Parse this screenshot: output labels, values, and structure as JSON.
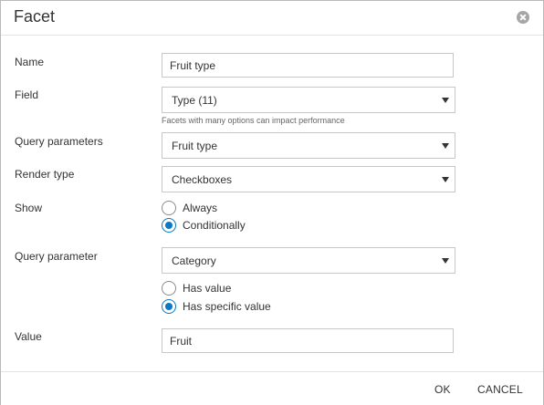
{
  "dialog": {
    "title": "Facet",
    "close_icon": "close-icon"
  },
  "form": {
    "name": {
      "label": "Name",
      "value": "Fruit type"
    },
    "field": {
      "label": "Field",
      "value": "Type (11)",
      "hint": "Facets with many options can impact performance"
    },
    "query_parameters": {
      "label": "Query parameters",
      "value": "Fruit type"
    },
    "render_type": {
      "label": "Render type",
      "value": "Checkboxes"
    },
    "show": {
      "label": "Show",
      "options": [
        {
          "label": "Always",
          "checked": false
        },
        {
          "label": "Conditionally",
          "checked": true
        }
      ]
    },
    "query_parameter": {
      "label": "Query parameter",
      "value": "Category",
      "options": [
        {
          "label": "Has value",
          "checked": false
        },
        {
          "label": "Has specific value",
          "checked": true
        }
      ]
    },
    "value": {
      "label": "Value",
      "value": "Fruit"
    }
  },
  "footer": {
    "ok_label": "OK",
    "cancel_label": "CANCEL"
  },
  "colors": {
    "accent": "#0a78c2",
    "border": "#c7c7c7",
    "close_icon_bg": "#a6a6a6"
  }
}
